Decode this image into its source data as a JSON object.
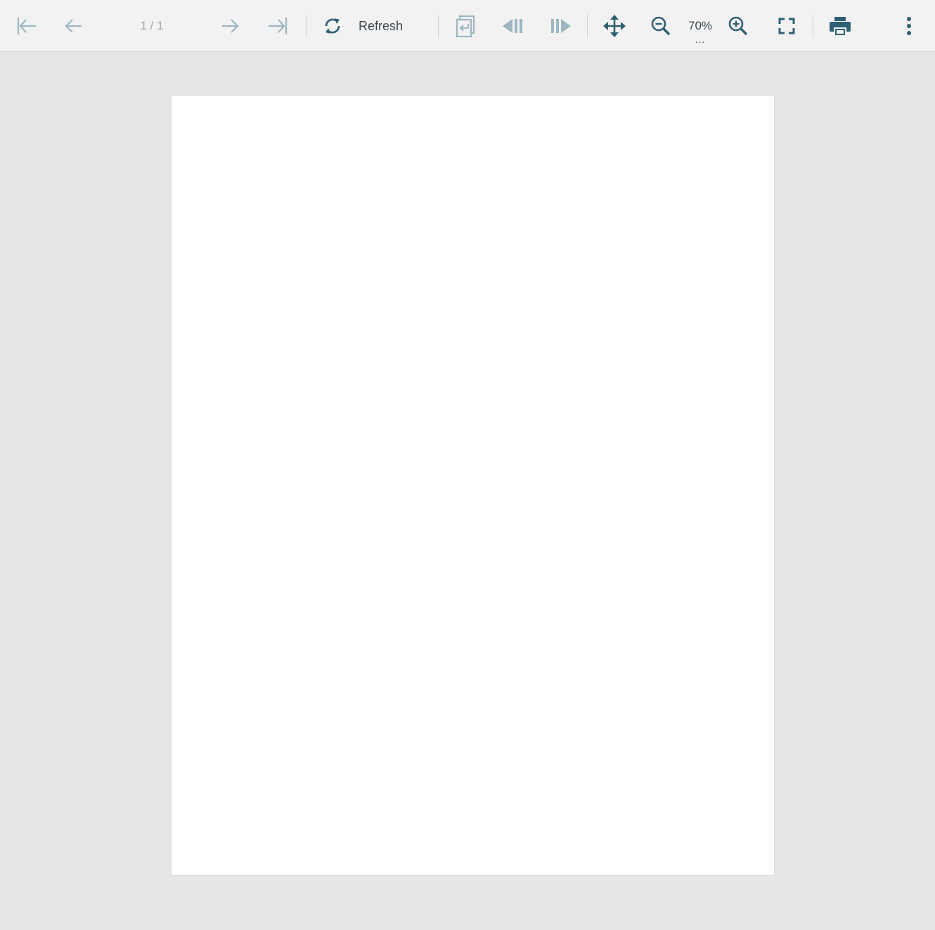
{
  "toolbar": {
    "page_indicator": "1 / 1",
    "refresh_label": "Refresh",
    "zoom_level": "70%",
    "zoom_more": "...",
    "icons": {
      "first_page": "first-page-icon",
      "previous_page": "previous-page-icon",
      "next_page": "next-page-icon",
      "last_page": "last-page-icon",
      "refresh": "refresh-icon",
      "back_to_parent": "back-to-parent-icon",
      "search_previous": "search-previous-icon",
      "search_next": "search-next-icon",
      "pan": "pan-icon",
      "zoom_out": "zoom-out-icon",
      "zoom_in": "zoom-in-icon",
      "fullscreen": "fullscreen-icon",
      "print": "print-icon",
      "more": "more-options-icon"
    }
  },
  "colors": {
    "active_icon": "#2e5f73",
    "disabled_icon": "#9db6c1",
    "toolbar_bg": "#f2f2f2",
    "canvas_bg": "#e6e6e6",
    "page_bg": "#ffffff"
  }
}
